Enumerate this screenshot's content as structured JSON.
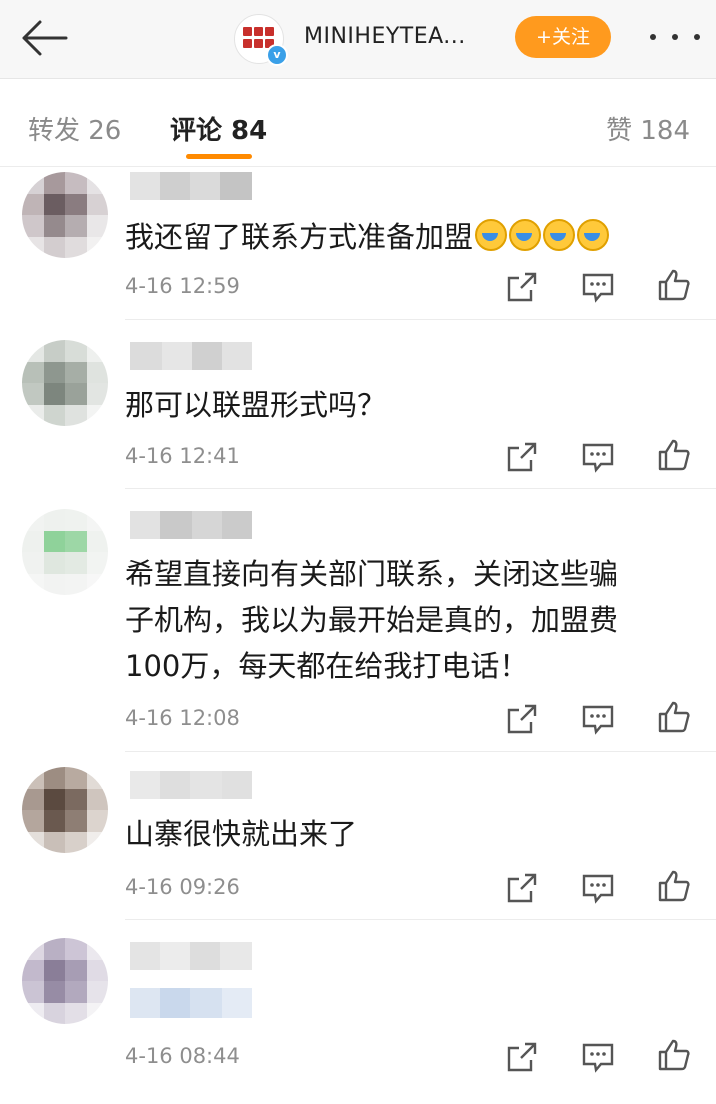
{
  "header": {
    "account_name": "MINIHEYTEA...",
    "follow_label": "+关注"
  },
  "tabs": {
    "repost": "转发 26",
    "comments": "评论 84",
    "likes": "赞 184"
  },
  "comments": [
    {
      "text": "我还留了联系方式准备加盟",
      "time": "4-16 12:59",
      "emoji_count": 4
    },
    {
      "text": "那可以联盟形式吗？",
      "time": "4-16 12:41"
    },
    {
      "text_lines": [
        "希望直接向有关部门联系，关闭这些骗",
        "子机构，我以为最开始是真的，加盟费",
        "100万，每天都在给我打电话！"
      ],
      "time": "4-16 12:08"
    },
    {
      "text": "山寨很快就出来了",
      "time": "4-16 09:26"
    },
    {
      "text": "",
      "time": "4-16 08:44"
    }
  ],
  "colors": {
    "accent": "#ff8a00",
    "follow_button": "#ff9a1e",
    "verified_badge": "#3aa0e8"
  },
  "icons": [
    "back-arrow-icon",
    "more-icon",
    "repost-icon",
    "comment-icon",
    "like-icon"
  ]
}
